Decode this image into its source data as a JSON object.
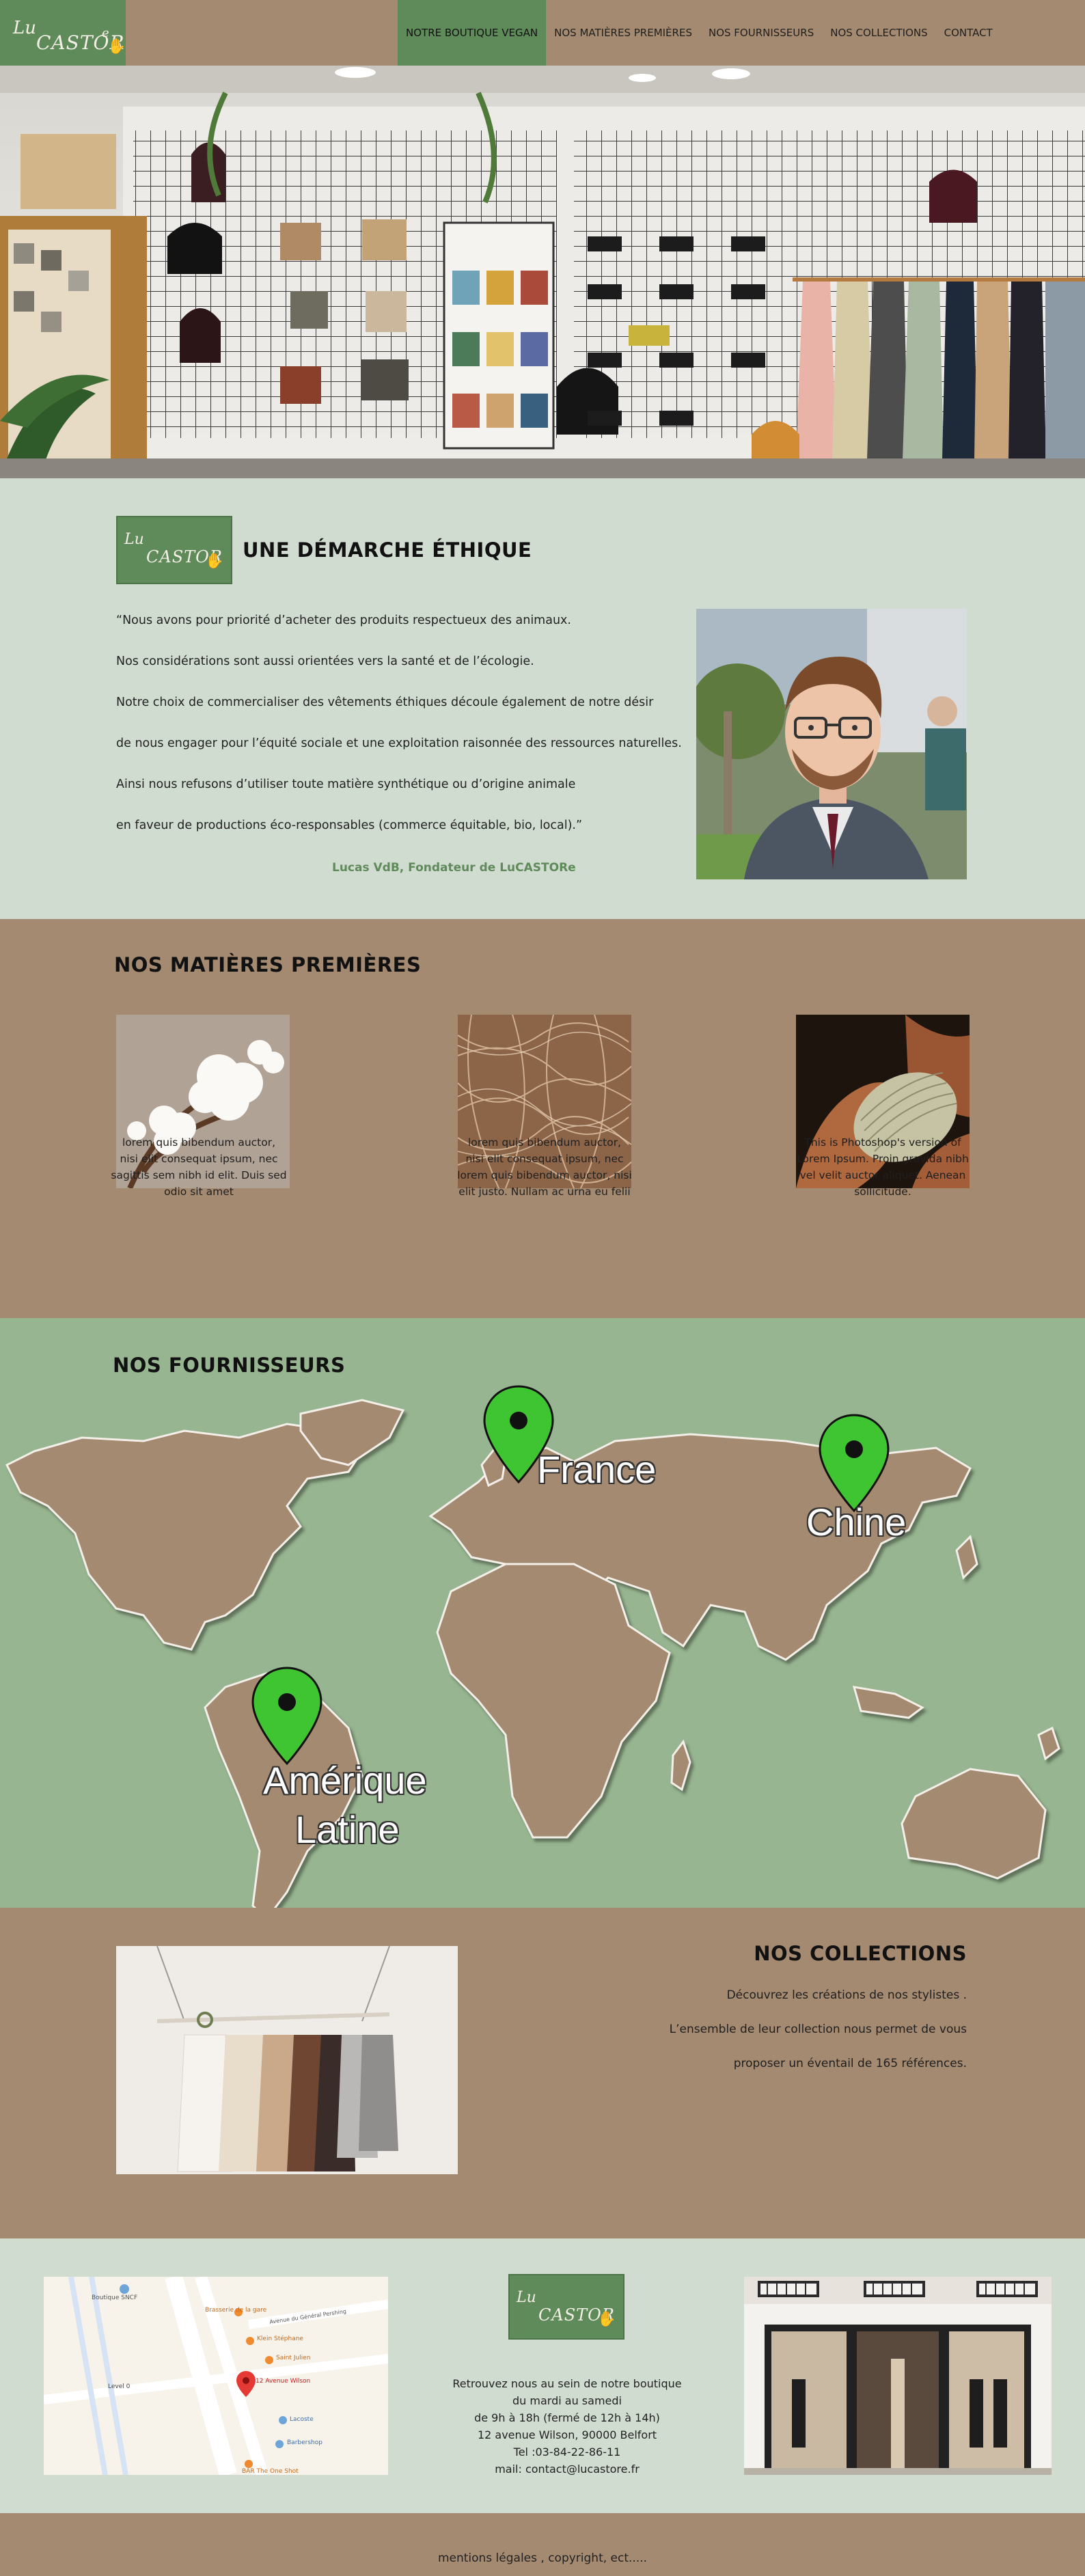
{
  "brand": {
    "lu": "Lu",
    "castor": "CASTOR",
    "e": "e"
  },
  "nav": {
    "items": [
      {
        "label": "NOTRE BOUTIQUE VEGAN",
        "active": true
      },
      {
        "label": "NOS MATIÈRES  PREMIÈRES"
      },
      {
        "label": "NOS FOURNISSEURS"
      },
      {
        "label": "NOS COLLECTIONS"
      },
      {
        "label": "CONTACT"
      }
    ]
  },
  "ethique": {
    "title": "UNE DÉMARCHE ÉTHIQUE",
    "quote_lines": [
      "“Nous avons pour priorité d’acheter des produits respectueux des animaux.",
      " Nos considérations sont aussi orientées vers la santé et de l’écologie.",
      "Notre choix de commercialiser des vêtements éthiques découle également de notre désir",
      "de nous engager pour l’équité sociale et une exploitation raisonnée des ressources naturelles.",
      "Ainsi nous refusons d’utiliser toute matière synthétique ou d’origine animale",
      "en faveur de productions éco-responsables (commerce équitable, bio, local).”"
    ],
    "signature": "Lucas VdB, Fondateur de LuCASTORe"
  },
  "matieres": {
    "title": "NOS MATIÈRES  PREMIÈRES",
    "items": [
      {
        "lines": [
          "lorem quis bibendum auctor,",
          "nisi elit consequat ipsum, nec",
          "sagittis sem nibh id elit. Duis sed",
          "odio sit amet"
        ]
      },
      {
        "lines": [
          "lorem quis bibendum auctor,",
          "nisi elit consequat ipsum, nec",
          "lorem quis bibendum auctor, nisi",
          "elit  justo. Nullam ac urna eu felii"
        ]
      },
      {
        "lines": [
          "This is Photoshop's version  of",
          "Lorem Ipsum. Proin gravida nibh",
          "vel velit auctor aliquet. Aenean",
          "sollicitude."
        ]
      }
    ]
  },
  "fournisseurs": {
    "title": "NOS FOURNISSEURS",
    "pins": [
      {
        "label": "France"
      },
      {
        "label": "Chine"
      },
      {
        "label_line1": "Amérique",
        "label_line2": "Latine"
      }
    ]
  },
  "collections": {
    "title": "NOS COLLECTIONS",
    "lines": [
      "Découvrez les créations de nos stylistes .",
      "L’ensemble de leur collection nous permet de vous",
      "proposer un éventail de 165 références."
    ]
  },
  "contact": {
    "address_lines": [
      "Retrouvez nous au sein de notre boutique",
      "du mardi au samedi",
      "de 9h à 18h (fermé de  12h à 14h)",
      "12 avenue Wilson, 90000 Belfort",
      "Tel :03-84-22-86-11",
      "mail: contact@lucastore.fr"
    ],
    "map_labels": {
      "gare": "Boutique SNCF",
      "brasserie": "Brasserie de la gare",
      "avenue": "Avenue du Général Pershing",
      "klein": "Klein Stéphane",
      "saint_julien": "Saint Julien",
      "wilson": "12 Avenue Wilson",
      "level": "Level 0",
      "lacoste": "Lacoste",
      "barbershop": "Barbershop",
      "bar": "BAR The One Shot"
    }
  },
  "footer": {
    "text": "mentions légales , copyright, ect....."
  },
  "colors": {
    "brown": "#a48a71",
    "green": "#5f8a5a",
    "mint": "#d1dcd1",
    "sage": "#97b591",
    "pin": "#3fc532"
  }
}
